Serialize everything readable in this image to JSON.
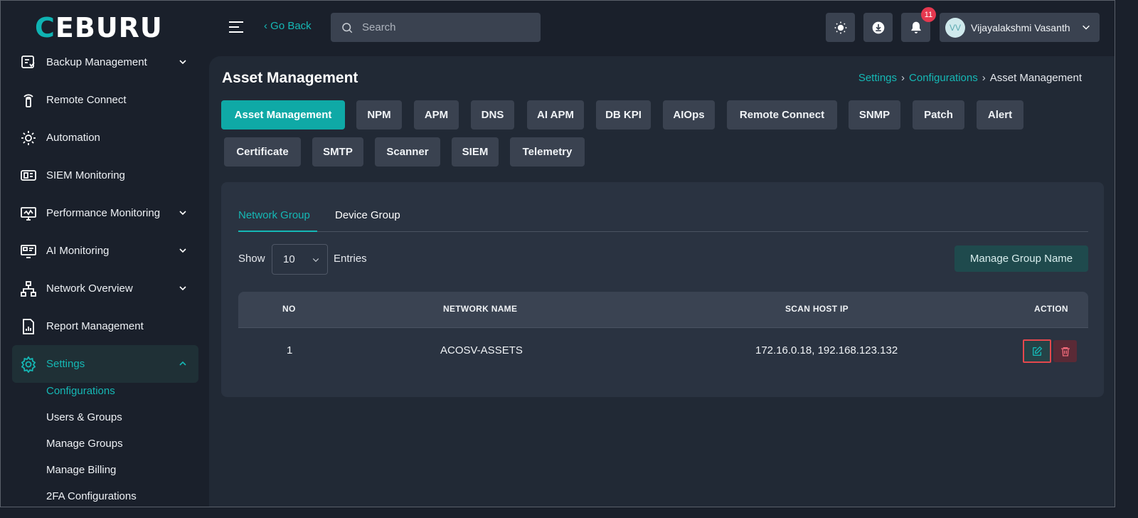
{
  "brand": {
    "logo_text": "EBURU",
    "logo_first": "C"
  },
  "sidebar": {
    "items": [
      {
        "label": "Backup Management",
        "icon": "backup-icon",
        "has_chevron": true
      },
      {
        "label": "Remote Connect",
        "icon": "remote-connect-icon",
        "has_chevron": false
      },
      {
        "label": "Automation",
        "icon": "automation-gear-icon",
        "has_chevron": false
      },
      {
        "label": "SIEM Monitoring",
        "icon": "siem-icon",
        "has_chevron": false
      },
      {
        "label": "Performance Monitoring",
        "icon": "performance-monitor-icon",
        "has_chevron": true
      },
      {
        "label": "AI Monitoring",
        "icon": "ai-monitor-icon",
        "has_chevron": true
      },
      {
        "label": "Network Overview",
        "icon": "network-tree-icon",
        "has_chevron": true
      },
      {
        "label": "Report Management",
        "icon": "report-icon",
        "has_chevron": false
      },
      {
        "label": "Settings",
        "icon": "settings-gear-icon",
        "has_chevron": true,
        "active": true
      }
    ],
    "settings_sub": [
      {
        "label": "Configurations",
        "active": true
      },
      {
        "label": "Users & Groups"
      },
      {
        "label": "Manage Groups"
      },
      {
        "label": "Manage Billing"
      },
      {
        "label": "2FA Configurations"
      }
    ]
  },
  "topbar": {
    "go_back": "‹ Go Back",
    "search_placeholder": "Search",
    "notification_count": "11",
    "user_initials": "VV",
    "user_name": "Vijayalakshmi Vasanth"
  },
  "page": {
    "title": "Asset Management",
    "breadcrumb": [
      "Settings",
      "Configurations",
      "Asset Management"
    ]
  },
  "config_tabs": [
    "Asset Management",
    "NPM",
    "APM",
    "DNS",
    "AI APM",
    "DB KPI",
    "AIOps",
    "Remote Connect",
    "SNMP",
    "Patch",
    "Alert",
    "Certificate",
    "SMTP",
    "Scanner",
    "SIEM",
    "Telemetry"
  ],
  "active_config_tab": "Asset Management",
  "group_tabs": [
    "Network Group",
    "Device Group"
  ],
  "active_group_tab": "Network Group",
  "table_controls": {
    "show_label": "Show",
    "entries_value": "10",
    "entries_label": "Entries",
    "manage_button": "Manage Group Name"
  },
  "table": {
    "columns": [
      "NO",
      "NETWORK NAME",
      "SCAN HOST IP",
      "ACTION"
    ],
    "rows": [
      {
        "no": "1",
        "network_name": "ACOSV-ASSETS",
        "scan_host_ip": "172.16.0.18, 192.168.123.132"
      }
    ]
  },
  "colors": {
    "accent": "#15b8b5",
    "active_button": "#0fa9a6",
    "danger": "#e5484d",
    "background": "#1a202b"
  }
}
